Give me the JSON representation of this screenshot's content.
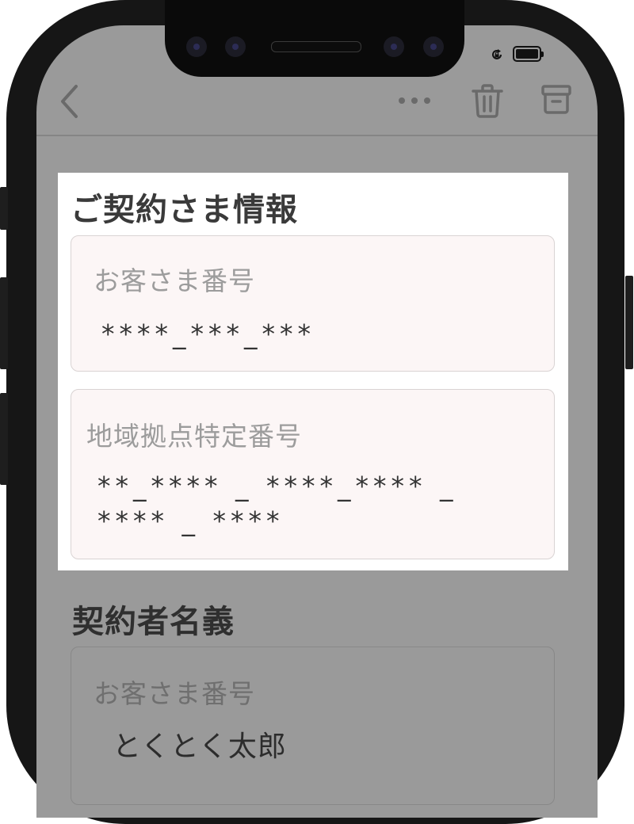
{
  "section_contract": {
    "heading": "ご契約さま情報",
    "customer_number": {
      "label": "お客さま番号",
      "value": "****_***_***"
    },
    "area_number": {
      "label": "地域拠点特定番号",
      "value_line1": "**_**** _ ****_**** _",
      "value_line2": "**** _ ****"
    }
  },
  "section_holder": {
    "heading": "契約者名義",
    "name_field": {
      "label": "お客さま番号",
      "value": "とくとく太郎"
    }
  },
  "toolbar": {
    "icons": [
      "back-chevron-icon",
      "more-icon",
      "trash-icon",
      "archive-icon"
    ]
  },
  "status_bar": {
    "icons": [
      "orientation-lock-icon",
      "battery-icon"
    ]
  }
}
